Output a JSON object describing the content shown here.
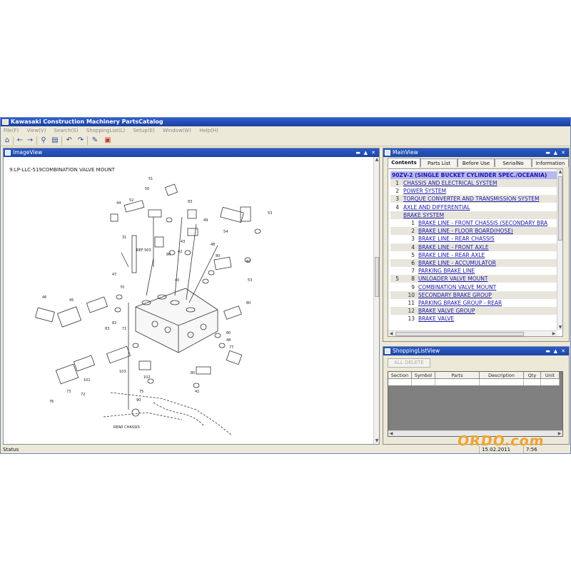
{
  "window": {
    "title": "Kawasaki Construction Machinery PartsCatalog"
  },
  "menu": [
    {
      "label": "File(F)"
    },
    {
      "label": "View(V)"
    },
    {
      "label": "Search(S)"
    },
    {
      "label": "ShoppingList(L)"
    },
    {
      "label": "Setup(E)"
    },
    {
      "label": "Window(W)"
    },
    {
      "label": "Help(H)"
    }
  ],
  "toolbar": {
    "icons": [
      "home-icon",
      "back-icon",
      "forward-icon",
      "search-icon",
      "print-icon",
      "undo-icon",
      "redo-icon",
      "edit-icon",
      "calendar-icon"
    ]
  },
  "image_view": {
    "title": "ImageView",
    "drawing_title": "9:LP-LLC-519COMBINATION VALVE MOUNT",
    "labels": {
      "ref": "REF 503",
      "rear_chassis": "REAR CHASSIS"
    },
    "part_numbers": [
      "51",
      "50",
      "52",
      "83",
      "44",
      "53",
      "49",
      "54",
      "31",
      "43",
      "80",
      "42",
      "48",
      "80",
      "82",
      "47",
      "40",
      "46",
      "45",
      "53",
      "70",
      "82",
      "83",
      "71",
      "80",
      "48",
      "77",
      "80",
      "103",
      "101",
      "72",
      "76",
      "73",
      "102",
      "75",
      "90",
      "80",
      "41"
    ]
  },
  "main_view": {
    "title": "MainView",
    "tabs": [
      "Contents",
      "Parts List",
      "Before Use",
      "SerialNo",
      "Information"
    ],
    "active_tab": "Contents",
    "header_row": "90ZV-2 (SINGLE BUCKET CYLINDER SPEC./OCEANIA)",
    "rows": [
      {
        "num": "1",
        "text": "CHASSIS AND ELECTRICAL SYSTEM",
        "level": 1
      },
      {
        "num": "2",
        "text": "POWER SYSTEM",
        "level": 1
      },
      {
        "num": "3",
        "text": "TORQUE CONVERTER AND TRANSMISSION SYSTEM",
        "level": 1
      },
      {
        "num": "4",
        "text": "AXLE AND DIFFERENTIAL",
        "level": 1
      },
      {
        "num": "",
        "text": "BRAKE SYSTEM",
        "level": 1
      },
      {
        "num": "1",
        "text": "BRAKE LINE - FRONT CHASSIS (SECONDARY BRA",
        "level": 2
      },
      {
        "num": "2",
        "text": "BRAKE LINE - FLOOR BOARD(HOSE)",
        "level": 2
      },
      {
        "num": "3",
        "text": "BRAKE LINE - REAR CHASSIS",
        "level": 2
      },
      {
        "num": "4",
        "text": "BRAKE LINE - FRONT AXLE",
        "level": 2
      },
      {
        "num": "5",
        "text": "BRAKE LINE - REAR AXLE",
        "level": 2
      },
      {
        "num": "6",
        "text": "BRAKE LINE - ACCUMULATOR",
        "level": 2
      },
      {
        "num": "7",
        "text": "PARKING BRAKE LINE",
        "level": 2
      },
      {
        "num": "8",
        "text": "UNLOADER VALVE MOUNT",
        "level": 2,
        "parent_num": "5"
      },
      {
        "num": "9",
        "text": "COMBINATION VALVE MOUNT",
        "level": 2
      },
      {
        "num": "10",
        "text": "SECONDARY BRAKE GROUP",
        "level": 2
      },
      {
        "num": "11",
        "text": "PARKING BRAKE GROUP - REAR",
        "level": 2
      },
      {
        "num": "12",
        "text": "BRAKE VALVE GROUP",
        "level": 2
      },
      {
        "num": "13",
        "text": "BRAKE VALVE",
        "level": 2
      }
    ]
  },
  "shopping_list": {
    "title": "ShoppingListView",
    "all_delete_label": "ALL DELETE",
    "columns": [
      "Section",
      "Symbol",
      "Parts",
      "Description",
      "Qty",
      "Unit"
    ]
  },
  "status": {
    "left": "Status",
    "date": "15.02.2011",
    "time": "7:56"
  },
  "watermark": "ORDO.com",
  "colors": {
    "title_bar": "#1d46a5",
    "header_row_bg": "#b7b7f2",
    "link": "#1a1aa8",
    "watermark": "#f0a233"
  }
}
